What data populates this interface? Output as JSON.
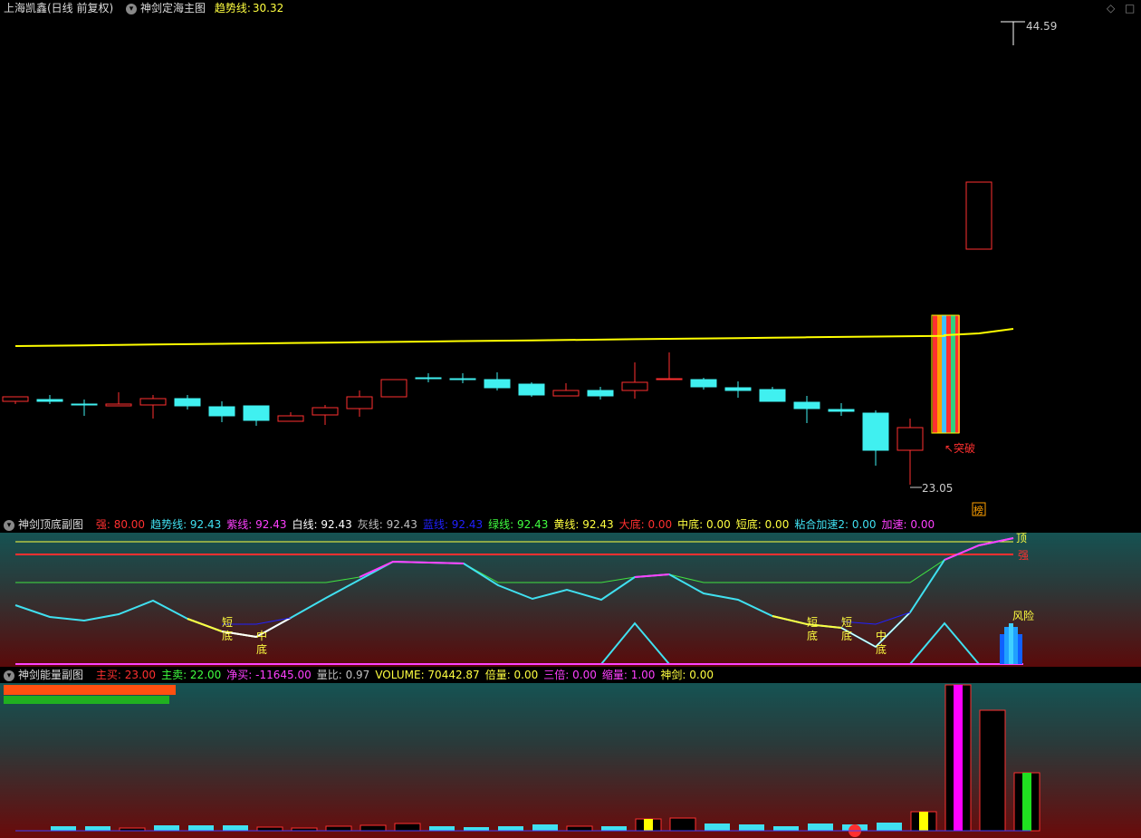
{
  "main": {
    "stock": "上海凯鑫(日线 前复权)",
    "indicator": "神剑定海主图",
    "trend_label": "趋势线:",
    "trend_value": "30.32",
    "high_label": "44.59",
    "low_label": "23.05",
    "break_label": "突破",
    "rank_label": "榜"
  },
  "sub1": {
    "title": "神剑顶底副图",
    "fields": [
      {
        "label": "强:",
        "value": "80.00",
        "color": "#ff3030"
      },
      {
        "label": "趋势线:",
        "value": "92.43",
        "color": "#40e0f0"
      },
      {
        "label": "紫线:",
        "value": "92.43",
        "color": "#ff40ff"
      },
      {
        "label": "白线:",
        "value": "92.43",
        "color": "#ffffff"
      },
      {
        "label": "灰线:",
        "value": "92.43",
        "color": "#c0c0c0"
      },
      {
        "label": "蓝线:",
        "value": "92.43",
        "color": "#2020ff"
      },
      {
        "label": "绿线:",
        "value": "92.43",
        "color": "#40ff40"
      },
      {
        "label": "黄线:",
        "value": "92.43",
        "color": "#ffff40"
      },
      {
        "label": "大底:",
        "value": "0.00",
        "color": "#ff3030"
      },
      {
        "label": "中底:",
        "value": "0.00",
        "color": "#ffff40"
      },
      {
        "label": "短底:",
        "value": "0.00",
        "color": "#ffff40"
      },
      {
        "label": "粘合加速2:",
        "value": "0.00",
        "color": "#40e0f0"
      },
      {
        "label": "加速:",
        "value": "0.00",
        "color": "#ff40ff"
      }
    ],
    "label_top": "顶",
    "label_strong": "强",
    "label_risk": "风险",
    "label_short": "短",
    "label_bottom": "底",
    "label_mid": "中"
  },
  "sub2": {
    "title": "神剑能量副图",
    "fields": [
      {
        "label": "主买:",
        "value": "23.00",
        "color": "#ff3030"
      },
      {
        "label": "主卖:",
        "value": "22.00",
        "color": "#40ff40"
      },
      {
        "label": "净买:",
        "value": "-11645.00",
        "color": "#ff40ff"
      },
      {
        "label": "量比:",
        "value": "0.97",
        "color": "#c0c0c0"
      },
      {
        "label": "VOLUME:",
        "value": "70442.87",
        "color": "#ffff40"
      },
      {
        "label": "倍量:",
        "value": "0.00",
        "color": "#ffff40"
      },
      {
        "label": "三倍:",
        "value": "0.00",
        "color": "#ff40ff"
      },
      {
        "label": "缩量:",
        "value": "1.00",
        "color": "#ff40ff"
      },
      {
        "label": "神剑:",
        "value": "0.00",
        "color": "#ffff40"
      }
    ]
  },
  "colors": {
    "up": "#ff3030",
    "down": "#40f0f0",
    "trend": "#ffff00"
  }
}
